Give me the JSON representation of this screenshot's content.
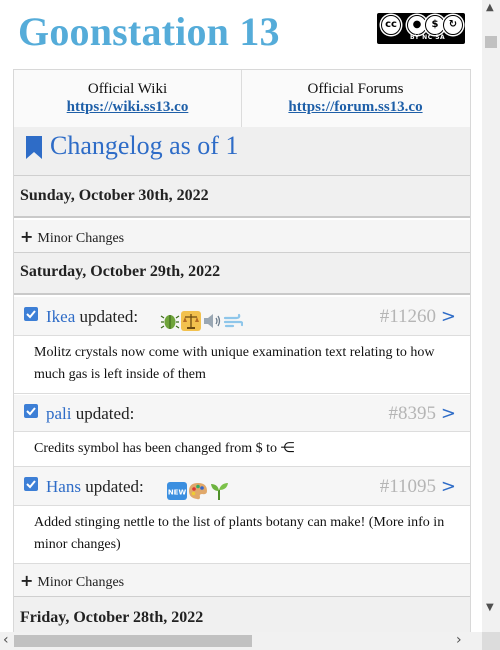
{
  "site": {
    "title": "Goonstation 13"
  },
  "license": {
    "text": "BY NC SA"
  },
  "links": [
    {
      "title": "Official Wiki",
      "url": "https://wiki.ss13.co"
    },
    {
      "title": "Official Forums",
      "url": "https://forum.ss13.co"
    }
  ],
  "changelog": {
    "title": "Changelog as of 1",
    "days": [
      {
        "date": "Sunday, October 30th, 2022",
        "minor_label": "Minor Changes"
      },
      {
        "date": "Saturday, October 29th, 2022",
        "entries": [
          {
            "author": "Ikea",
            "updated": "updated:",
            "pr": "#11260",
            "icons": [
              "bug-icon",
              "balance-icon",
              "sound-icon",
              "wind-icon"
            ],
            "text": "Molitz crystals now come with unique examination text relating to how much gas is left inside of them"
          },
          {
            "author": "pali",
            "updated": "updated:",
            "pr": "#8395",
            "icons": [],
            "text": "Credits symbol has been changed from $ to ⋲"
          },
          {
            "author": "Hans",
            "updated": "updated:",
            "pr": "#11095",
            "icons": [
              "new-icon",
              "palette-icon",
              "seedling-icon"
            ],
            "text": "Added stinging nettle to the list of plants botany can make! (More info in minor changes)"
          }
        ],
        "minor_label": "Minor Changes"
      },
      {
        "date": "Friday, October 28th, 2022"
      }
    ]
  },
  "colors": {
    "title": "#55acd9",
    "link": "#2e6cc7",
    "pr": "#b5b5b5"
  },
  "chevron": ">"
}
